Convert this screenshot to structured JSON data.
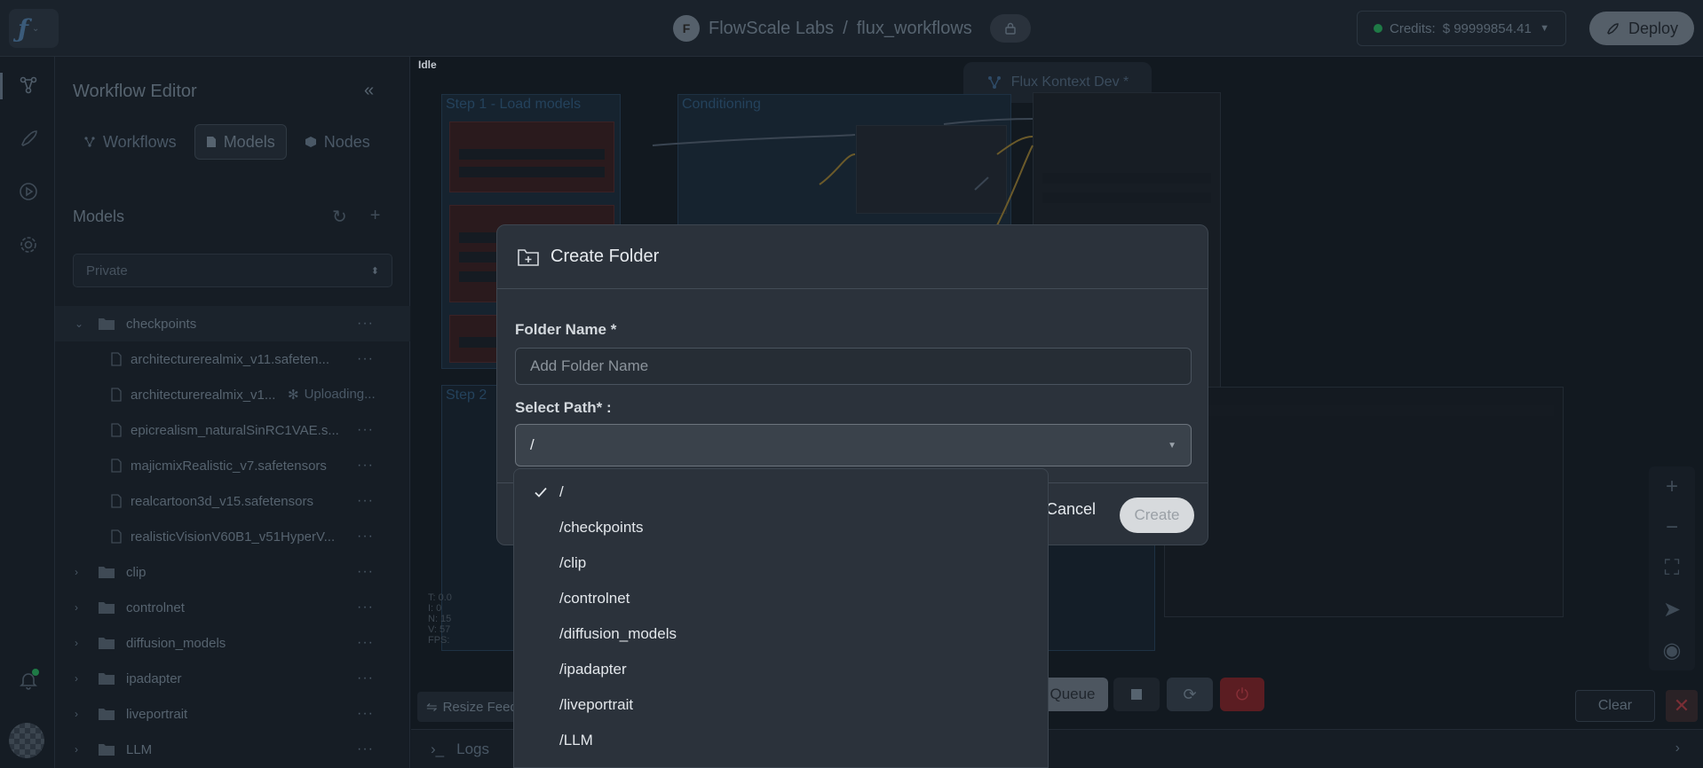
{
  "header": {
    "org_initial": "F",
    "org_name": "FlowScale Labs",
    "separator": "/",
    "project": "flux_workflows",
    "credits_label": "Credits:",
    "credits_value": "$ 99999854.41",
    "deploy_label": "Deploy"
  },
  "sidebar": {
    "title": "Workflow Editor",
    "tabs": [
      {
        "label": "Workflows"
      },
      {
        "label": "Models"
      },
      {
        "label": "Nodes"
      }
    ],
    "models_heading": "Models",
    "scope_select": "Private",
    "tree": [
      {
        "type": "folder",
        "label": "checkpoints",
        "expanded": true
      },
      {
        "type": "file",
        "label": "architecturerealmix_v11.safeten..."
      },
      {
        "type": "file",
        "label": "architecturerealmix_v1...",
        "status": "Uploading..."
      },
      {
        "type": "file",
        "label": "epicrealism_naturalSinRC1VAE.s..."
      },
      {
        "type": "file",
        "label": "majicmixRealistic_v7.safetensors"
      },
      {
        "type": "file",
        "label": "realcartoon3d_v15.safetensors"
      },
      {
        "type": "file",
        "label": "realisticVisionV60B1_v51HyperV..."
      },
      {
        "type": "folder",
        "label": "clip"
      },
      {
        "type": "folder",
        "label": "controlnet"
      },
      {
        "type": "folder",
        "label": "diffusion_models"
      },
      {
        "type": "folder",
        "label": "ipadapter"
      },
      {
        "type": "folder",
        "label": "liveportrait"
      },
      {
        "type": "folder",
        "label": "LLM"
      }
    ]
  },
  "canvas": {
    "status": "Idle",
    "workflow_name": "Flux Kontext Dev *",
    "groups": [
      {
        "title": "Step 1 - Load models"
      },
      {
        "title": "Conditioning"
      },
      {
        "title": "Step 2"
      }
    ],
    "stats": [
      "T: 0.0",
      "I: 0",
      "N: 15",
      "V: 57",
      "FPS:"
    ],
    "queue_label": "Queue",
    "resize_label": "Resize Feed",
    "clear_label": "Clear",
    "logs_label": "Logs"
  },
  "modal": {
    "title": "Create Folder",
    "name_label": "Folder Name *",
    "name_placeholder": "Add Folder Name",
    "name_value": "",
    "path_label": "Select Path* :",
    "path_value": "/",
    "cancel_label": "Cancel",
    "create_label": "Create",
    "path_options": [
      {
        "label": "/",
        "selected": true
      },
      {
        "label": "/checkpoints"
      },
      {
        "label": "/clip"
      },
      {
        "label": "/controlnet"
      },
      {
        "label": "/diffusion_models"
      },
      {
        "label": "/ipadapter"
      },
      {
        "label": "/liveportrait"
      },
      {
        "label": "/LLM"
      }
    ]
  },
  "colors": {
    "background": "#131a22",
    "modal": "#2b323b",
    "credits_dot": "#1f7a46",
    "power_button": "#5b1d22"
  }
}
